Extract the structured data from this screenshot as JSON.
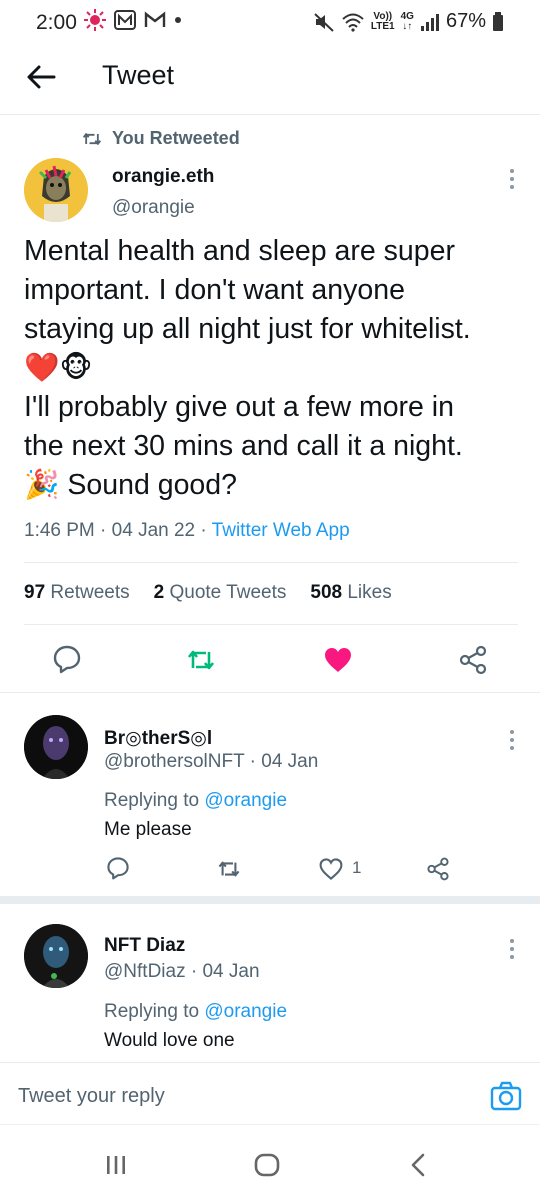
{
  "status_bar": {
    "time": "2:00",
    "volte_top": "Vo))",
    "volte_bottom": "LTE1",
    "network_gen": "4G",
    "battery": "67%"
  },
  "header": {
    "title": "Tweet"
  },
  "main_tweet": {
    "retweet_label": "You Retweeted",
    "author_name": "orangie.eth",
    "author_handle": "@orangie",
    "text_lines": [
      "Mental health and sleep are super",
      "important. I don't want anyone",
      "staying up all night just for whitelist.",
      "❤️🐵",
      "I'll probably give out a few more in",
      "the next 30 mins and call it a night.",
      "🎉 Sound good?"
    ],
    "time": "1:46 PM",
    "date": "04 Jan 22",
    "source": "Twitter Web App",
    "retweets_count": "97",
    "retweets_label": "Retweets",
    "quotes_count": "2",
    "quotes_label": "Quote Tweets",
    "likes_count": "508",
    "likes_label": "Likes"
  },
  "replies": [
    {
      "name": "Br◎therS◎l",
      "handle": "@brothersolNFT",
      "date": "04 Jan",
      "replying_prefix": "Replying to",
      "replying_to": "@orangie",
      "text": "Me please",
      "like_count": "1"
    },
    {
      "name": "NFT Diaz",
      "handle": "@NftDiaz",
      "date": "04 Jan",
      "replying_prefix": "Replying to",
      "replying_to": "@orangie",
      "text": "Would love one"
    }
  ],
  "compose": {
    "placeholder": "Tweet your reply"
  },
  "colors": {
    "accent": "#1d9bf0",
    "retweet_green": "#00ba7c",
    "like_pink": "#f91880",
    "muted": "#536471"
  }
}
